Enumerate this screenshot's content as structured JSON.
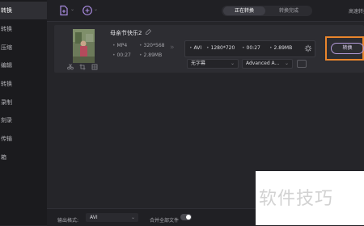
{
  "sidebar": {
    "items": [
      {
        "label": "转换",
        "active": true
      },
      {
        "label": "转换",
        "active": false
      },
      {
        "label": "压缩",
        "active": false
      },
      {
        "label": "编辑",
        "active": false
      },
      {
        "label": "转换",
        "active": false
      },
      {
        "label": "录制",
        "active": false
      },
      {
        "label": "刻录",
        "active": false
      },
      {
        "label": "传输",
        "active": false
      },
      {
        "label": "箱",
        "active": false
      }
    ]
  },
  "toolbar": {
    "add_file_icon": "add-file-icon",
    "add_dvd_icon": "dvd-add-icon",
    "tabs": [
      {
        "label": "正在转换",
        "active": true
      },
      {
        "label": "转换完成",
        "active": false
      }
    ],
    "high_speed_label": "高速转换"
  },
  "file_card": {
    "name": "母亲节快乐2",
    "source": {
      "format": "MP4",
      "resolution": "320*568",
      "duration": "00:27",
      "size": "2.89MB"
    },
    "target": {
      "format": "AVI",
      "resolution": "1280*720",
      "duration": "00:27",
      "size": "2.89MB"
    },
    "subtitle_option": "无字幕",
    "audio_option": "Advanced A...",
    "convert_label": "转换"
  },
  "bottom": {
    "output_format_label": "输出格式:",
    "output_format_value": "AVI",
    "merge_label": "合并全部文件",
    "merge_enabled": false
  },
  "watermark": {
    "text": "软件技巧"
  },
  "colors": {
    "accent": "#e9852c",
    "convert_border": "#b39ad8",
    "background": "#252529",
    "sidebar": "#1b1b1e"
  }
}
